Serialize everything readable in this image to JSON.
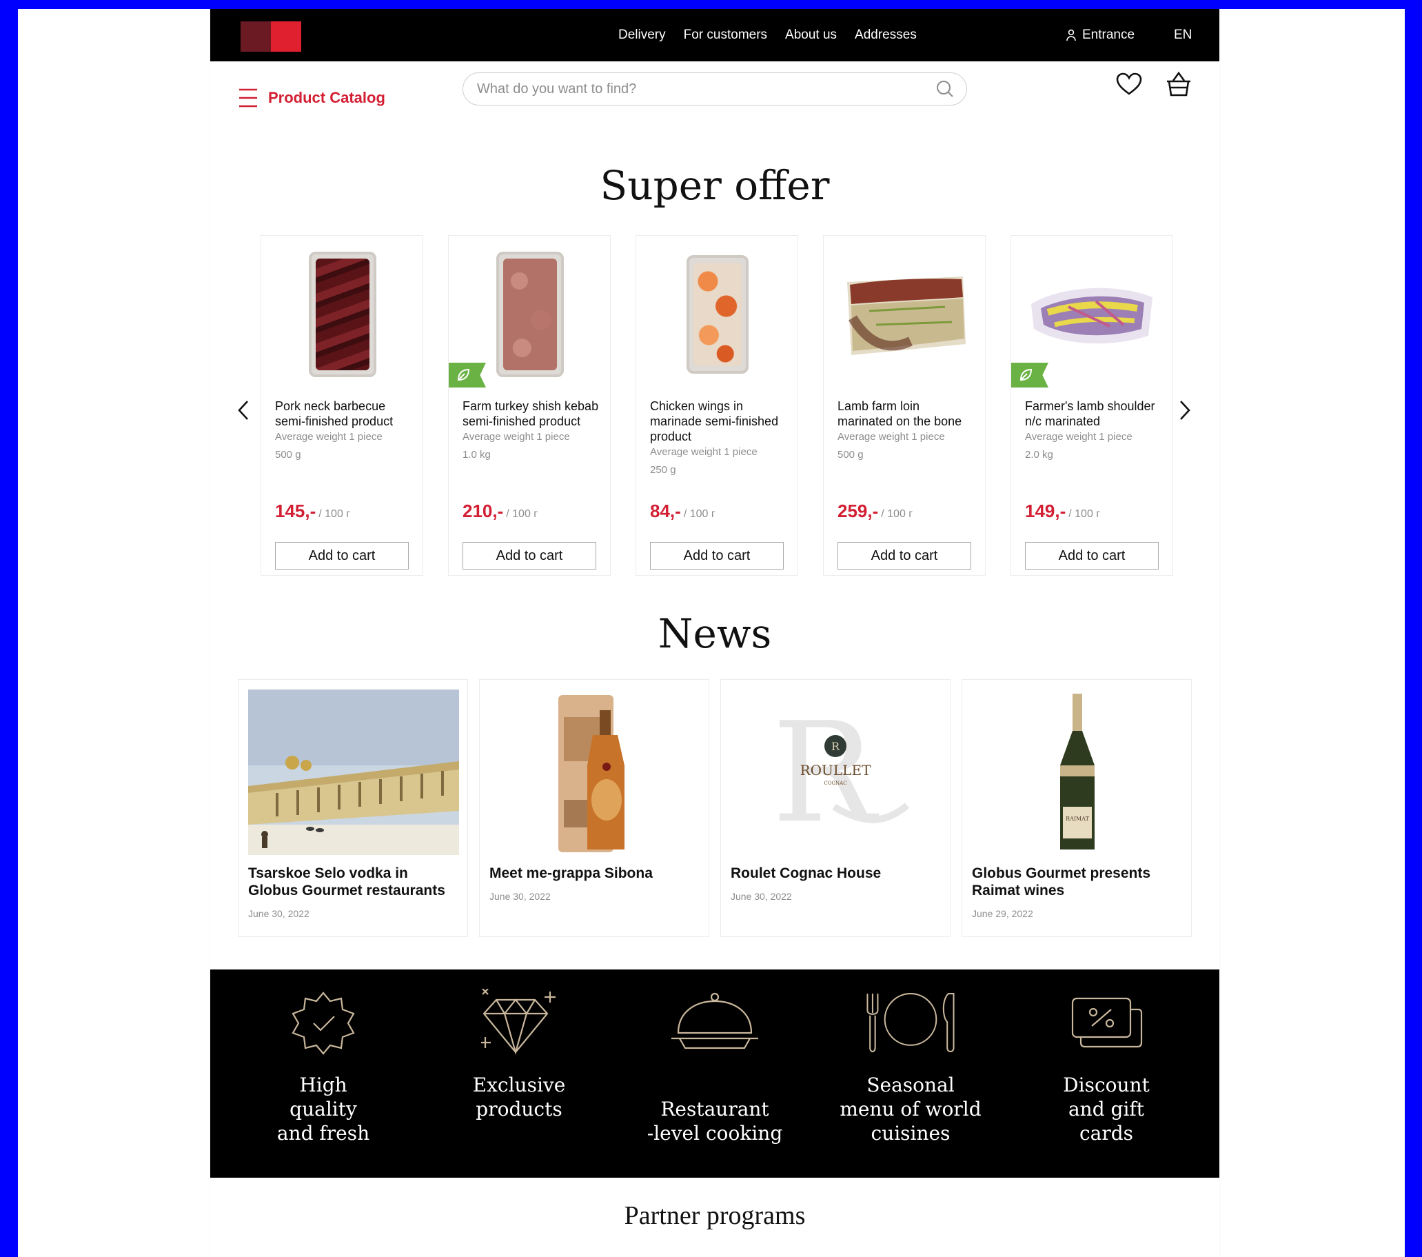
{
  "topbar": {
    "nav": [
      "Delivery",
      "For customers",
      "About us",
      "Addresses"
    ],
    "entrance": "Entrance",
    "lang": "EN"
  },
  "header": {
    "catalog": "Product Catalog",
    "search_placeholder": "What do you want to find?"
  },
  "super_offer": {
    "title": "Super offer",
    "products": [
      {
        "name": "Pork neck barbecue semi-finished product",
        "weight_label": "Average weight 1 piece",
        "weight": "500 g",
        "price": "145,-",
        "unit": "/ 100 г",
        "button": "Add to cart"
      },
      {
        "name": "Farm turkey shish kebab semi-finished product",
        "weight_label": "Average weight 1 piece",
        "weight": "1.0 kg",
        "price": "210,-",
        "unit": "/ 100 г",
        "button": "Add to cart"
      },
      {
        "name": "Chicken wings in marinade semi-finished product",
        "weight_label": "Average weight 1 piece",
        "weight": "250 g",
        "price": "84,-",
        "unit": "/ 100 г",
        "button": "Add to cart"
      },
      {
        "name": "Lamb farm loin marinated on the bone",
        "weight_label": "Average weight 1 piece",
        "weight": "500 g",
        "price": "259,-",
        "unit": "/ 100 г",
        "button": "Add to cart"
      },
      {
        "name": "Farmer's lamb shoulder n/c marinated",
        "weight_label": "Average weight 1 piece",
        "weight": "2.0 kg",
        "price": "149,-",
        "unit": "/ 100 г",
        "button": "Add to cart"
      }
    ]
  },
  "news": {
    "title": "News",
    "items": [
      {
        "title": "Tsarskoe Selo vodka in Globus Gourmet restaurants",
        "date": "June 30, 2022"
      },
      {
        "title": "Meet me-grappa Sibona",
        "date": "June 30, 2022"
      },
      {
        "title": "Roulet Cognac House",
        "date": "June 30, 2022"
      },
      {
        "title": "Globus Gourmet presents Raimat wines",
        "date": "June 29, 2022"
      }
    ]
  },
  "images": {
    "roullet_logo": "ROULLET",
    "roullet_sub": "COGNAC",
    "raimat_label": "RAIMAT"
  },
  "features": [
    {
      "icon": "badge-check-icon",
      "lines": [
        "High",
        "quality",
        "and fresh"
      ]
    },
    {
      "icon": "diamond-icon",
      "lines": [
        "Exclusive",
        "products"
      ]
    },
    {
      "icon": "cloche-icon",
      "lines": [
        "Restaurant",
        "-level cooking"
      ]
    },
    {
      "icon": "plate-cutlery-icon",
      "lines": [
        "Seasonal",
        "menu of world",
        "cuisines"
      ]
    },
    {
      "icon": "discount-card-icon",
      "lines": [
        "Discount",
        "and gift",
        "cards"
      ]
    }
  ],
  "partner_programs": {
    "title": "Partner programs"
  },
  "colors": {
    "accent": "#d31f33",
    "eco_badge": "#6ab244",
    "topbar": "#000000",
    "icon_gold": "#c9b79c"
  }
}
